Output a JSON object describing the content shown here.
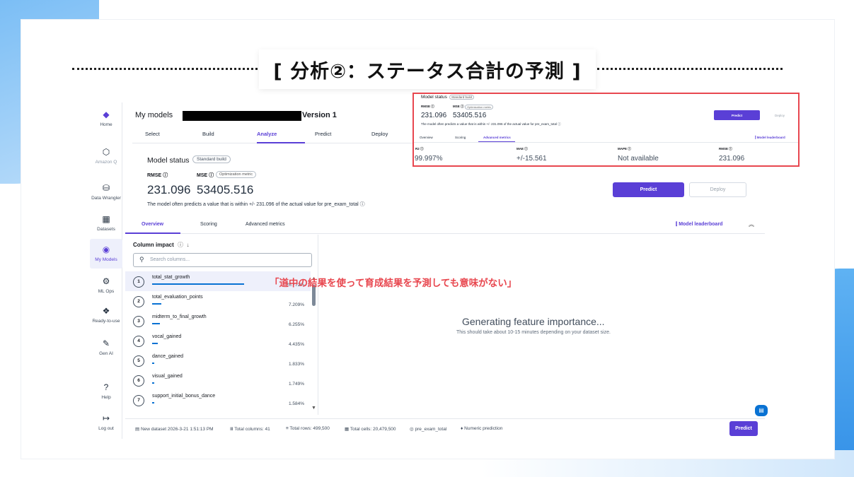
{
  "slide_title": "[ 分析②：ステータス合計の予測 ]",
  "sidebar": {
    "items": [
      {
        "label": "Home",
        "icon": "home-icon"
      },
      {
        "label": "Amazon Q",
        "icon": "amazon-q-icon"
      },
      {
        "label": "Data Wrangler",
        "icon": "data-wrangler-icon"
      },
      {
        "label": "Datasets",
        "icon": "datasets-icon"
      },
      {
        "label": "My Models",
        "icon": "my-models-icon"
      },
      {
        "label": "ML Ops",
        "icon": "ml-ops-icon"
      },
      {
        "label": "Ready-to-use",
        "icon": "ready-to-use-icon"
      },
      {
        "label": "Gen AI",
        "icon": "gen-ai-icon"
      },
      {
        "label": "Help",
        "icon": "help-icon"
      },
      {
        "label": "Log out",
        "icon": "logout-icon"
      }
    ],
    "active": "My Models"
  },
  "header": {
    "title_prefix": "My models",
    "version": "Version 1",
    "tabs": [
      "Select",
      "Build",
      "Analyze",
      "Predict",
      "Deploy"
    ],
    "active_tab": "Analyze"
  },
  "model_status": {
    "label": "Model status",
    "build_badge": "Standard build",
    "rmse_label": "RMSE",
    "mse_label": "MSE",
    "optimization_badge": "Optimization metric",
    "rmse_value": "231.096",
    "mse_value": "53405.516",
    "description": "The model often predicts a value that is within +/- 231.096 of the actual value for pre_exam_total",
    "predict_button": "Predict",
    "deploy_button": "Deploy"
  },
  "sub_tabs": {
    "items": [
      "Overview",
      "Scoring",
      "Advanced metrics"
    ],
    "active": "Overview",
    "leaderboard": "Model leaderboard"
  },
  "column_impact": {
    "title": "Column impact",
    "search_placeholder": "Search columns...",
    "rows": [
      {
        "rank": "1",
        "name": "total_stat_growth",
        "pct": "70.772%",
        "value": 70.772
      },
      {
        "rank": "2",
        "name": "total_evaluation_points",
        "pct": "7.209%",
        "value": 7.209
      },
      {
        "rank": "3",
        "name": "midterm_to_final_growth",
        "pct": "6.255%",
        "value": 6.255
      },
      {
        "rank": "4",
        "name": "vocal_gained",
        "pct": "4.435%",
        "value": 4.435
      },
      {
        "rank": "5",
        "name": "dance_gained",
        "pct": "1.833%",
        "value": 1.833
      },
      {
        "rank": "6",
        "name": "visual_gained",
        "pct": "1.749%",
        "value": 1.749
      },
      {
        "rank": "7",
        "name": "support_initial_bonus_dance",
        "pct": "1.584%",
        "value": 1.584
      }
    ]
  },
  "feature_importance": {
    "title": "Generating feature importance...",
    "subtitle": "This should take about 10-15 minutes depending on your dataset size."
  },
  "annotation": "「道中の結果を使って育成結果を予測しても意味がない」",
  "footer": {
    "dataset": "New dataset 2026-3-21 1:51:13 PM",
    "columns": "Total columns: 41",
    "rows": "Total rows: 499,500",
    "cells": "Total cells: 20,479,500",
    "target": "pre_exam_total",
    "problem": "Numeric prediction",
    "predict_button": "Predict"
  },
  "inset": {
    "model_status": "Model status",
    "build_badge": "Standard build",
    "rmse_label": "RMSE",
    "mse_label": "MSE",
    "optimization_badge": "Optimization metric",
    "rmse_value": "231.096",
    "mse_value": "53405.516",
    "description": "The model often predicts a value that is within +/- 231.096 of the actual value for pre_exam_total",
    "predict_button": "Predict",
    "deploy_button": "Deploy",
    "tabs": [
      "Overview",
      "Scoring",
      "Advanced metrics"
    ],
    "leaderboard": "Model leaderboard",
    "metrics": [
      {
        "label": "R2",
        "value": "99.997%"
      },
      {
        "label": "MAE",
        "value": "+/-15.561"
      },
      {
        "label": "MAPE",
        "value": "Not available"
      },
      {
        "label": "RMSE",
        "value": "231.096"
      }
    ]
  },
  "colors": {
    "accent": "#5a3fd6",
    "highlight_red": "#e8474f",
    "bar_blue": "#0972d3"
  }
}
